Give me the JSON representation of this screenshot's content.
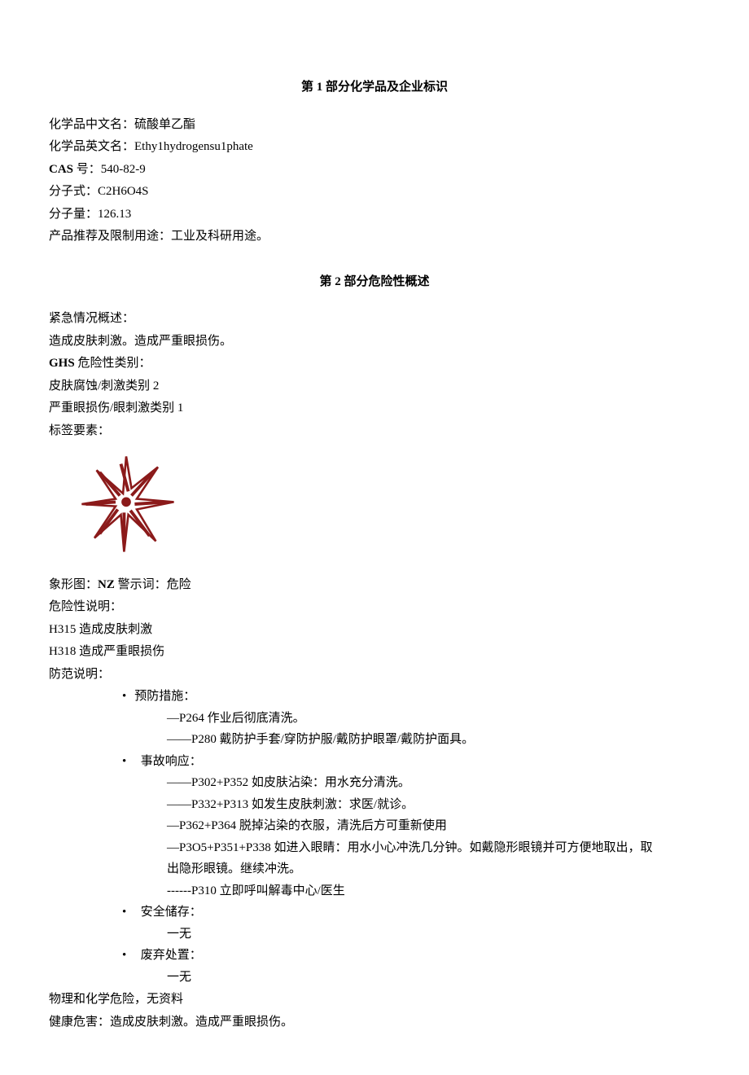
{
  "section1": {
    "title_prefix": "第",
    "title_num": "1",
    "title_suffix": "部分化学品及企业标识",
    "chinese_name_label": "化学品中文名：",
    "chinese_name_value": "硫酸单乙酯",
    "english_name_label": "化学品英文名：",
    "english_name_value": "Ethy1hydrogensu1phate",
    "cas_label": "CAS",
    "cas_suffix": " 号：",
    "cas_value": "540-82-9",
    "formula_label": "分子式：",
    "formula_value": "C2H6O4S",
    "weight_label": "分子量：",
    "weight_value": "126.13",
    "usage_label": "产品推荐及限制用途：",
    "usage_value": "工业及科研用途。"
  },
  "section2": {
    "title_prefix": "第",
    "title_num": "2",
    "title_suffix": "部分危险性概述",
    "emergency_label": "紧急情况概述：",
    "emergency_value": "造成皮肤刺激。造成严重眼损伤。",
    "ghs_label_bold": "GHS",
    "ghs_label_suffix": " 危险性类别：",
    "ghs_cat1": "皮肤腐蚀/刺激类别 2",
    "ghs_cat2": "严重眼损伤/眼刺激类别 1",
    "label_elements": "标签要素：",
    "pictogram_label": "象形图：",
    "pictogram_bold": "NZ",
    "signal_label": " 警示词：",
    "signal_value": "危险",
    "hazard_label": "危险性说明：",
    "h315": "H315 造成皮肤刺激",
    "h318": "H318 造成严重眼损伤",
    "prevention_header": "防范说明：",
    "prevention_title": "预防措施：",
    "p264": "—P264 作业后彻底清洗。",
    "p280": "——P280 戴防护手套/穿防护服/戴防护眼罩/戴防护面具。",
    "response_title": "事故响应：",
    "p302": "——P302+P352 如皮肤沾染：用水充分清洗。",
    "p332": "——P332+P313 如发生皮肤刺激：求医/就诊。",
    "p362": "—P362+P364 脱掉沾染的衣服，清洗后方可重新使用",
    "p305": "—P3O5+P351+P338 如进入眼睛：用水小心冲洗几分钟。如戴隐形眼镜并可方便地取出，取",
    "p305_cont": "出隐形眼镜。继续冲洗。",
    "p310": "------P310 立即呼叫解毒中心/医生",
    "storage_title": "安全储存：",
    "storage_value": "一无",
    "disposal_title": "废弃处置：",
    "disposal_value": "一无",
    "physical_label": "物理和化学危险，",
    "physical_value": "无资料",
    "health_label": "健康危害：",
    "health_value": "造成皮肤刺激。造成严重眼损伤。"
  }
}
